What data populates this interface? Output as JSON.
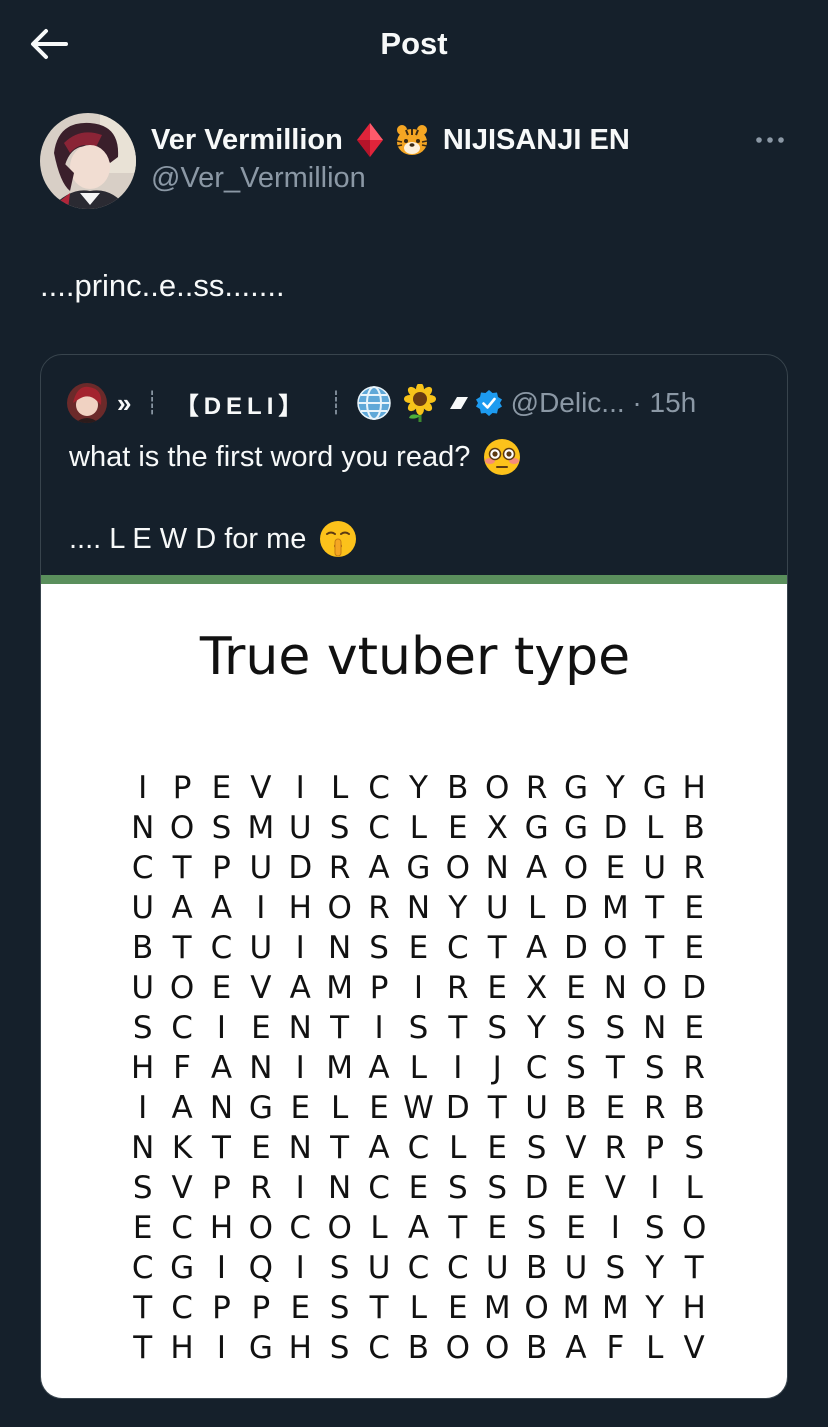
{
  "topbar": {
    "title": "Post"
  },
  "post": {
    "display_name": "Ver Vermillion",
    "affiliation": "NIJISANJI EN",
    "handle": "@Ver_Vermillion",
    "text": "....princ..e..ss......."
  },
  "quote": {
    "name_raquo": "»",
    "name_bar": "┊",
    "name_deli": "【DELI】",
    "handle_time": "@Delic... · 15h",
    "line1": "what is the first word you read?",
    "line2": ".... L E W D for me",
    "image": {
      "title": "True vtuber type",
      "rows": [
        "IPEVILCYBORGYGH",
        "NOSMUSCLEXGGDLB",
        "CTPUDRAGONAOEUR",
        "UAAIHORNYULDMTE",
        "BTCUINSECTADOTE",
        "UOEVAMPIREXENOD",
        "SCIENTISTSYSSNE",
        "HFANIMALIJCSTSR",
        "IANGELEWDTUBERB",
        "NKTENTACLESVRPS",
        "SVPRINCESSDEVIL",
        "ECHOCOLATESEISO",
        "CGIQISUCCUBUSYT",
        "TCPPESTLEMOMMYH",
        "THIGHSCBOOBAFLV"
      ]
    }
  },
  "icons": {
    "back": "arrow-left-icon",
    "more": "ellipsis-icon",
    "diamond": "red-diamond-emoji",
    "tiger": "tiger-face-emoji",
    "globe": "globe-emoji",
    "sunflower": "sunflower-emoji",
    "verified": "verified-badge-icon"
  },
  "colors": {
    "background": "#15202b",
    "secondary_text": "#8b98a5",
    "verified_blue": "#1d9bf0",
    "divider": "#38444d"
  }
}
